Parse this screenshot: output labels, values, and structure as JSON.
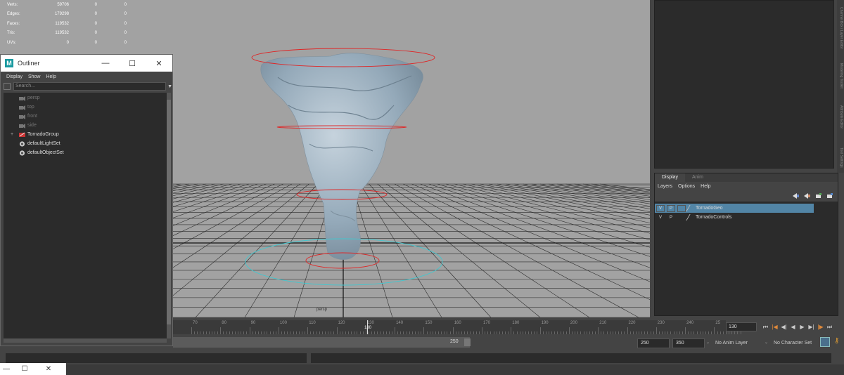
{
  "hud": {
    "rows": [
      {
        "label": "Verts:",
        "v1": "59706",
        "v2": "0",
        "v3": "0"
      },
      {
        "label": "Edges:",
        "v1": "179298",
        "v2": "0",
        "v3": "0"
      },
      {
        "label": "Faces:",
        "v1": "119532",
        "v2": "0",
        "v3": "0"
      },
      {
        "label": "Tris:",
        "v1": "119532",
        "v2": "0",
        "v3": "0"
      },
      {
        "label": "UVs:",
        "v1": "0",
        "v2": "0",
        "v3": "0"
      }
    ]
  },
  "viewport": {
    "camera_label": "persp"
  },
  "outliner": {
    "title": "Outliner",
    "logo": "M",
    "window_buttons": {
      "minimize": "—",
      "maximize": "☐",
      "close": "✕"
    },
    "menu": [
      "Display",
      "Show",
      "Help"
    ],
    "search_placeholder": "Search...",
    "items": [
      {
        "label": "persp",
        "kind": "camera",
        "icon": "camera-icon"
      },
      {
        "label": "top",
        "kind": "camera",
        "icon": "camera-icon"
      },
      {
        "label": "front",
        "kind": "camera",
        "icon": "camera-icon"
      },
      {
        "label": "side",
        "kind": "camera",
        "icon": "camera-icon"
      },
      {
        "label": "TornadoGroup",
        "kind": "group",
        "icon": "group-icon",
        "expander": "+"
      },
      {
        "label": "defaultLightSet",
        "kind": "set",
        "icon": "set-icon"
      },
      {
        "label": "defaultObjectSet",
        "kind": "set",
        "icon": "set-icon"
      }
    ]
  },
  "side_tabs": [
    "Channel Box / Layer Editor",
    "Modeling Toolkit",
    "Attribute Editor",
    "Tool Settings"
  ],
  "layer_editor": {
    "tabs": [
      "Display",
      "Anim"
    ],
    "menu": [
      "Layers",
      "Options",
      "Help"
    ],
    "layers": [
      {
        "v": "V",
        "p": "P",
        "name": "TornadoGeo",
        "selected": true
      },
      {
        "v": "V",
        "p": "P",
        "name": "TornadoControls",
        "selected": false
      }
    ]
  },
  "timeline": {
    "ticks": [
      "70",
      "80",
      "90",
      "100",
      "110",
      "120",
      "130",
      "140",
      "150",
      "160",
      "170",
      "180",
      "190",
      "200",
      "210",
      "220",
      "230",
      "240",
      "25"
    ],
    "current_marker": "130",
    "current_frame": "130",
    "playback_buttons": [
      "⏮",
      "|◀",
      "◀|",
      "◀",
      "▶",
      "▶|",
      "|▶",
      "⏭"
    ]
  },
  "range": {
    "end_label": "250",
    "start_field": "250",
    "end_field": "350",
    "anim_layer": "No Anim Layer",
    "character_set": "No Character Set",
    "dropdown_arrow": "⌄"
  },
  "mini_window": {
    "minimize": "—",
    "maximize": "☐",
    "close": "✕"
  },
  "colors": {
    "viewport_bg": "#a2a2a2",
    "selection_blue": "#5285a6",
    "control_red": "#e02424",
    "control_cyan": "#40c8d0",
    "tornado": "#9fb4c4"
  }
}
